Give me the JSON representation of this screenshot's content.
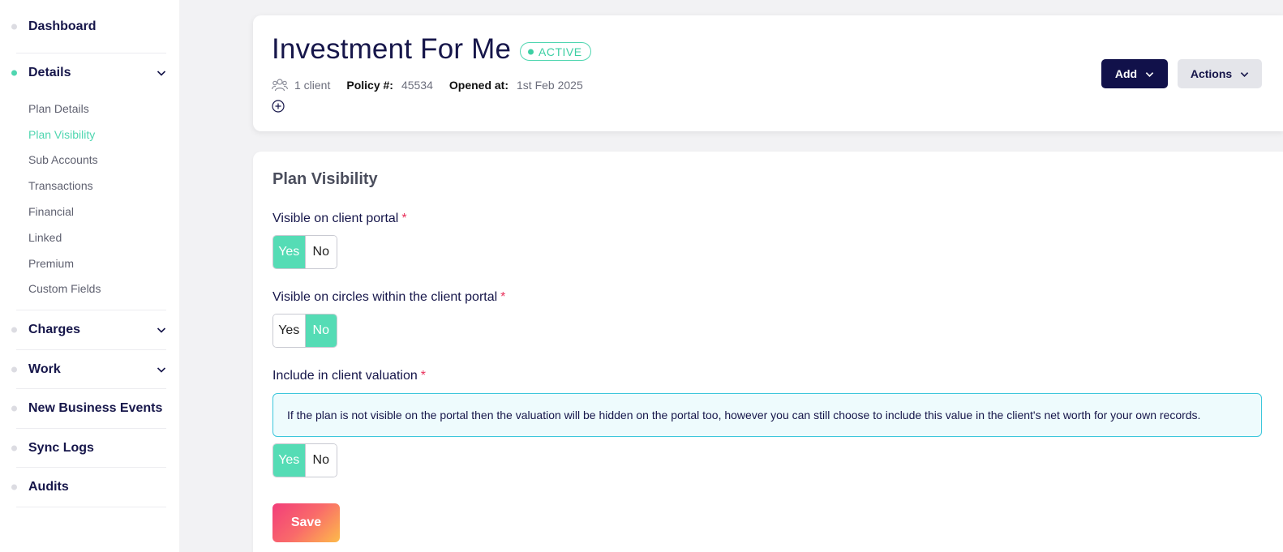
{
  "sidebar": {
    "dashboard": "Dashboard",
    "details": "Details",
    "details_items": [
      "Plan Details",
      "Plan Visibility",
      "Sub Accounts",
      "Transactions",
      "Financial",
      "Linked",
      "Premium",
      "Custom Fields"
    ],
    "charges": "Charges",
    "work": "Work",
    "new_business_events": "New Business Events",
    "sync_logs": "Sync Logs",
    "audits": "Audits",
    "active_item": "Plan Visibility"
  },
  "header": {
    "title": "Investment For Me",
    "status": "ACTIVE",
    "clients": "1 client",
    "policy_label": "Policy #:",
    "policy_value": "45534",
    "opened_label": "Opened at:",
    "opened_value": "1st Feb 2025",
    "add_button": "Add",
    "actions_button": "Actions"
  },
  "main": {
    "section_title": "Plan Visibility",
    "fields": [
      {
        "label": "Visible on client portal",
        "required_mark": "*",
        "options": [
          "Yes",
          "No"
        ],
        "selected": "Yes"
      },
      {
        "label": "Visible on circles within the client portal",
        "required_mark": "*",
        "options": [
          "Yes",
          "No"
        ],
        "selected": "No"
      },
      {
        "label": "Include in client valuation",
        "required_mark": "*",
        "options": [
          "Yes",
          "No"
        ],
        "selected": "Yes"
      }
    ],
    "info_text": "If the plan is not visible on the portal then the valuation will be hidden on the portal too, however you can still choose to include this value in the client's net worth for your own records.",
    "save_button": "Save"
  },
  "colors": {
    "accent": "#55dcb5",
    "navy": "#11114a",
    "info_border": "#3dc7dc",
    "required": "#e8315b"
  }
}
